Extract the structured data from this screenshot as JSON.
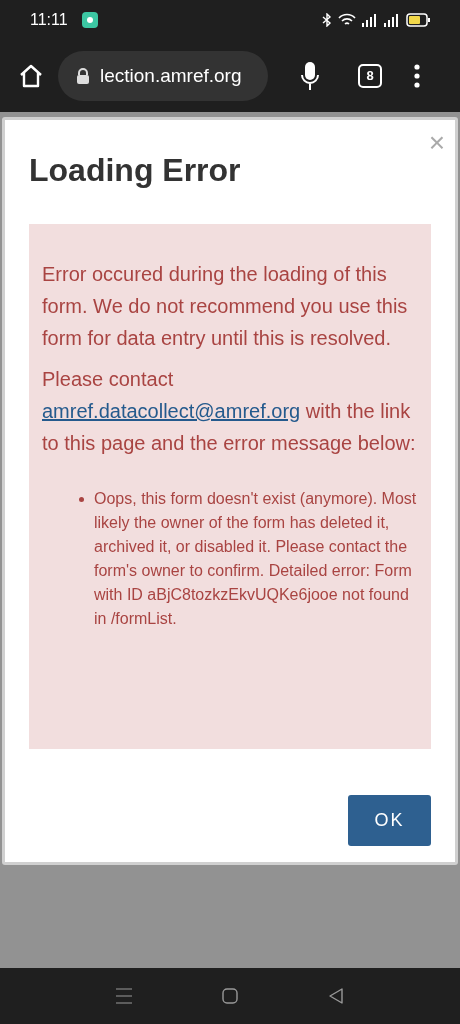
{
  "status_bar": {
    "time": "11:11"
  },
  "browser_toolbar": {
    "url": "lection.amref.org",
    "tab_count": "8"
  },
  "dialog": {
    "close": "×",
    "title": "Loading Error",
    "alert": {
      "paragraph_1": "Error occured during the loading of this form. We do not recommend you use this form for data entry until this is resolved.",
      "paragraph_2": {
        "before": "Please contact",
        "link": "amref.datacollect@amref.org",
        "after": "with the link to this page and the error message below:"
      },
      "errors": [
        "Oops, this form doesn't exist (anymore). Most likely the owner of the form has deleted it, archived it, or disabled it. Please contact the form's owner to confirm. Detailed error: Form with ID aBjC8tozkzEkvUQKe6jooe not found in /formList."
      ]
    },
    "buttons": [
      "OK"
    ]
  }
}
